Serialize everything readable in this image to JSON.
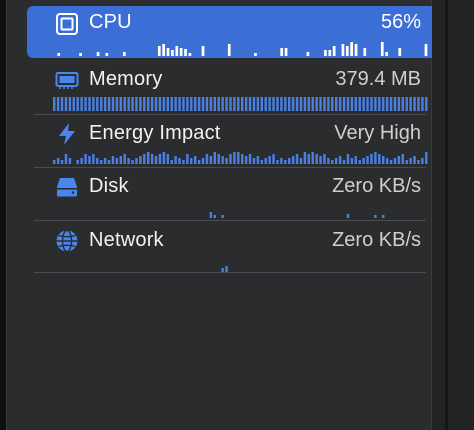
{
  "gauges": [
    {
      "id": "cpu",
      "label": "CPU",
      "value": "56%",
      "icon": "cpu-chip-icon",
      "selected": true
    },
    {
      "id": "memory",
      "label": "Memory",
      "value": "379.4 MB",
      "icon": "memory-module-icon",
      "selected": false
    },
    {
      "id": "energy",
      "label": "Energy Impact",
      "value": "Very High",
      "icon": "lightning-bolt-icon",
      "selected": false
    },
    {
      "id": "disk",
      "label": "Disk",
      "value": "Zero KB/s",
      "icon": "disk-drive-icon",
      "selected": false
    },
    {
      "id": "network",
      "label": "Network",
      "value": "Zero KB/s",
      "icon": "globe-network-icon",
      "selected": false
    }
  ],
  "colors": {
    "accent": "#3b6fd6",
    "bar": "#4a7fe0",
    "bar_on_selected": "#ffffff"
  },
  "sparklines": {
    "cpu": [
      0,
      3,
      0,
      0,
      0,
      0,
      3,
      0,
      0,
      0,
      4,
      0,
      3,
      0,
      0,
      0,
      4,
      0,
      0,
      0,
      0,
      0,
      0,
      0,
      10,
      12,
      8,
      6,
      10,
      8,
      7,
      3,
      0,
      0,
      10,
      0,
      0,
      0,
      0,
      0,
      12,
      0,
      0,
      0,
      0,
      0,
      3,
      0,
      0,
      0,
      0,
      0,
      8,
      8,
      0,
      0,
      0,
      0,
      4,
      0,
      0,
      0,
      6,
      6,
      10,
      0,
      12,
      10,
      14,
      12,
      0,
      8,
      0,
      0,
      0,
      14,
      4,
      0,
      0,
      8,
      0,
      0,
      0,
      0,
      0,
      12
    ],
    "memory": [
      1,
      1,
      1,
      1,
      1,
      1,
      1,
      1,
      1,
      1,
      1,
      1,
      1,
      1,
      1,
      1,
      1,
      1,
      1,
      1,
      1,
      1,
      1,
      1,
      1,
      1,
      1,
      1,
      1,
      1,
      1,
      1,
      1,
      1,
      1,
      1,
      1,
      1,
      1,
      1,
      1,
      1,
      1,
      1,
      1,
      1,
      1,
      1,
      1,
      1,
      1,
      1,
      1,
      1,
      1,
      1,
      1,
      1,
      1,
      1,
      1,
      1,
      1,
      1,
      1,
      1,
      1,
      1,
      1,
      1,
      1,
      1,
      1,
      1,
      1,
      1,
      1,
      1,
      1,
      1,
      1,
      1,
      1,
      1,
      1,
      1,
      1,
      1,
      1,
      1,
      1,
      1,
      1,
      1,
      1,
      1
    ],
    "energy": [
      4,
      6,
      4,
      10,
      6,
      0,
      4,
      6,
      10,
      8,
      10,
      6,
      4,
      6,
      4,
      8,
      6,
      8,
      10,
      6,
      4,
      6,
      8,
      10,
      12,
      10,
      8,
      10,
      12,
      10,
      4,
      8,
      6,
      4,
      10,
      6,
      8,
      4,
      6,
      10,
      8,
      12,
      10,
      8,
      6,
      10,
      12,
      12,
      10,
      8,
      10,
      6,
      8,
      4,
      6,
      8,
      10,
      4,
      6,
      4,
      6,
      8,
      10,
      6,
      12,
      10,
      12,
      10,
      8,
      10,
      6,
      4,
      6,
      8,
      4,
      10,
      6,
      8,
      4,
      6,
      8,
      10,
      12,
      10,
      8,
      6,
      4,
      6,
      8,
      10,
      4,
      6,
      8,
      4,
      6,
      12
    ],
    "disk": [
      0,
      0,
      0,
      0,
      0,
      0,
      0,
      0,
      0,
      0,
      0,
      0,
      0,
      0,
      0,
      0,
      0,
      0,
      0,
      0,
      0,
      0,
      0,
      0,
      0,
      0,
      0,
      0,
      0,
      0,
      0,
      0,
      0,
      0,
      0,
      0,
      0,
      0,
      0,
      0,
      6,
      3,
      0,
      3,
      0,
      0,
      0,
      0,
      0,
      0,
      0,
      0,
      0,
      0,
      0,
      0,
      0,
      0,
      0,
      0,
      0,
      0,
      0,
      0,
      0,
      0,
      0,
      0,
      0,
      0,
      0,
      0,
      0,
      0,
      0,
      4,
      0,
      0,
      0,
      0,
      0,
      0,
      3,
      0,
      3,
      0,
      0,
      0,
      0,
      0,
      0,
      0,
      0,
      0,
      0,
      0
    ],
    "network": [
      0,
      0,
      0,
      0,
      0,
      0,
      0,
      0,
      0,
      0,
      0,
      0,
      0,
      0,
      0,
      0,
      0,
      0,
      0,
      0,
      0,
      0,
      0,
      0,
      0,
      0,
      0,
      0,
      0,
      0,
      0,
      0,
      0,
      0,
      0,
      0,
      0,
      0,
      0,
      0,
      0,
      0,
      0,
      4,
      6,
      0,
      0,
      0,
      0,
      0,
      0,
      0,
      0,
      0,
      0,
      0,
      0,
      0,
      0,
      0,
      0,
      0,
      0,
      0,
      0,
      0,
      0,
      0,
      0,
      0,
      0,
      0,
      0,
      0,
      0,
      0,
      0,
      0,
      0,
      0,
      0,
      0,
      0,
      0,
      0,
      0,
      0,
      0,
      0,
      0,
      0,
      0,
      0,
      0,
      0,
      0
    ]
  }
}
